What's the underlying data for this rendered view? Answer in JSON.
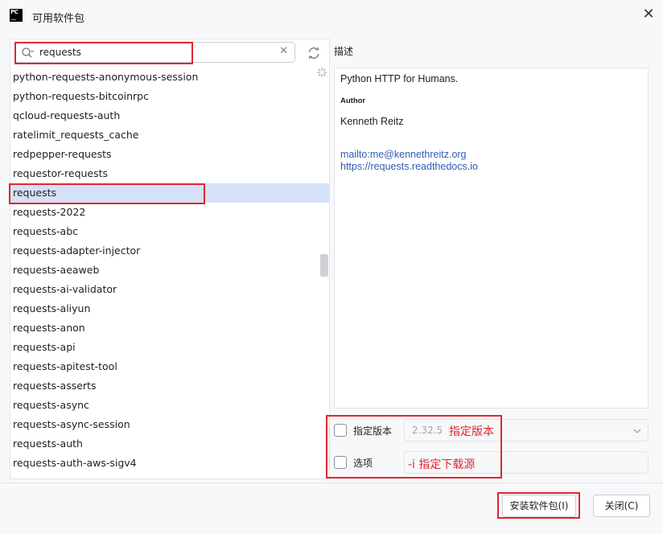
{
  "window": {
    "title": "可用软件包",
    "close_glyph": "✕"
  },
  "search": {
    "value": "requests",
    "clear_glyph": "✕"
  },
  "packages": [
    "python-requests-anonymous-session",
    "python-requests-bitcoinrpc",
    "qcloud-requests-auth",
    "ratelimit_requests_cache",
    "redpepper-requests",
    "requestor-requests",
    "requests",
    "requests-2022",
    "requests-abc",
    "requests-adapter-injector",
    "requests-aeaweb",
    "requests-ai-validator",
    "requests-aliyun",
    "requests-anon",
    "requests-api",
    "requests-apitest-tool",
    "requests-asserts",
    "requests-async",
    "requests-async-session",
    "requests-auth",
    "requests-auth-aws-sigv4"
  ],
  "selected_package": "requests",
  "description": {
    "label": "描述",
    "summary": "Python HTTP for Humans.",
    "author_heading": "Author",
    "author": "Kenneth Reitz",
    "email_link": "mailto:me@kennethreitz.org",
    "docs_link": "https://requests.readthedocs.io"
  },
  "options": {
    "specify_version_label": "指定版本",
    "version_value": "2.32.5",
    "options_label": "选项"
  },
  "annotations": {
    "version_note": "指定版本",
    "source_note": "-i 指定下载源"
  },
  "buttons": {
    "install": "安装软件包(I)",
    "close": "关闭(C)"
  },
  "colors": {
    "selection": "#d5e1f7",
    "annotation_red": "#e0262f",
    "link": "#2f5cb4"
  },
  "icons": [
    "pycharm-logo-icon",
    "search-icon",
    "clear-icon",
    "refresh-icon",
    "spinner-icon",
    "chevron-down-icon",
    "close-icon"
  ]
}
